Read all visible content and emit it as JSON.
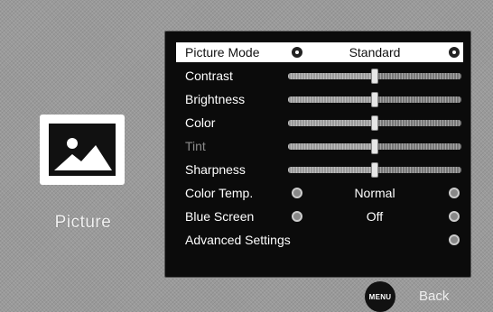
{
  "side": {
    "icon": "picture-landscape-icon",
    "label": "Picture"
  },
  "menu": {
    "picture_mode": {
      "label": "Picture Mode",
      "value": "Standard",
      "selected": true
    },
    "sliders": [
      {
        "id": "contrast",
        "label": "Contrast",
        "level": 0.5,
        "enabled": true
      },
      {
        "id": "brightness",
        "label": "Brightness",
        "level": 0.5,
        "enabled": true
      },
      {
        "id": "color",
        "label": "Color",
        "level": 0.5,
        "enabled": true
      },
      {
        "id": "tint",
        "label": "Tint",
        "level": 0.5,
        "enabled": false
      },
      {
        "id": "sharpness",
        "label": "Sharpness",
        "level": 0.5,
        "enabled": true
      }
    ],
    "color_temp": {
      "label": "Color Temp.",
      "value": "Normal"
    },
    "blue_screen": {
      "label": "Blue Screen",
      "value": "Off"
    },
    "advanced": {
      "label": "Advanced Settings"
    }
  },
  "footer": {
    "menu_button": "MENU",
    "back_label": "Back"
  },
  "colors": {
    "panel_bg": "#0b0b0b",
    "highlight_bg": "#ffffff",
    "background": "#9a9a9a"
  }
}
